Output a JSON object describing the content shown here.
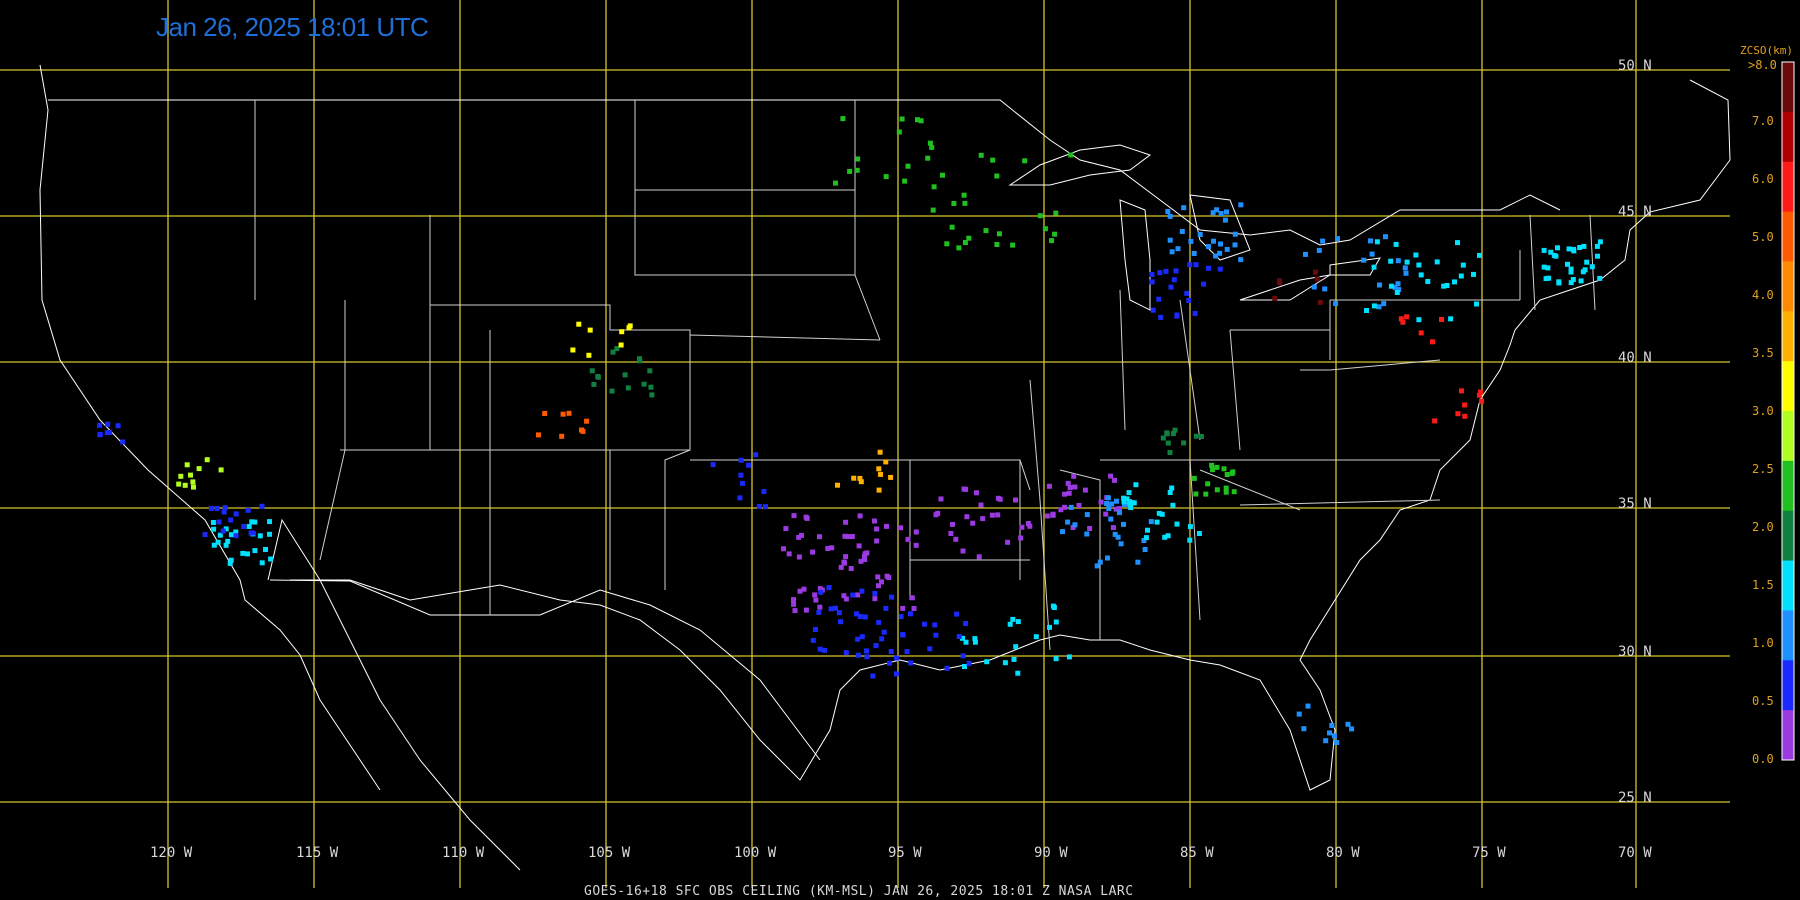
{
  "timestamp": "Jan 26, 2025 18:01 UTC",
  "footer": "GOES-16+18  SFC OBS CEILING (KM-MSL)   JAN 26, 2025 18:01 Z   NASA LARC",
  "latitude_labels": [
    "50 N",
    "45 N",
    "40 N",
    "35 N",
    "30 N",
    "25 N"
  ],
  "longitude_labels": [
    "120 W",
    "115 W",
    "110 W",
    "105 W",
    "100 W",
    "95 W",
    "90 W",
    "85 W",
    "80 W",
    "75 W",
    "70 W"
  ],
  "colorbar": {
    "title": "ZCSO(km)",
    "top_label": ">8.0",
    "ticks": [
      "7.0",
      "6.0",
      "5.0",
      "4.0",
      "3.5",
      "3.0",
      "2.5",
      "2.0",
      "1.5",
      "1.0",
      "0.5",
      "0.0"
    ],
    "colors": [
      "#6a0a0a",
      "#b00000",
      "#ff1a1a",
      "#ff5a00",
      "#ff8c00",
      "#ffb000",
      "#ffff00",
      "#b0ff20",
      "#20c020",
      "#108040",
      "#00e0ff",
      "#1f90ff",
      "#1a2aff",
      "#9a3ae0"
    ]
  },
  "colors": {
    "grid": "#d6c22e",
    "boundary": "#ffffff",
    "timestamp": "#1f6fd8"
  },
  "station_groups": [
    {
      "level": "0.0-0.5 km",
      "color": "#9a3ae0"
    },
    {
      "level": "0.5-1.0 km",
      "color": "#1a2aff"
    },
    {
      "level": "1.0-1.5 km",
      "color": "#1f90ff"
    },
    {
      "level": "1.5-2.0 km",
      "color": "#00e0ff"
    },
    {
      "level": "2.0-2.5 km",
      "color": "#108040"
    },
    {
      "level": "2.5-3.0 km",
      "color": "#20c020"
    },
    {
      "level": "3.0-3.5 km",
      "color": "#b0ff20"
    },
    {
      "level": "3.5-4.0 km",
      "color": "#ffff00"
    },
    {
      "level": "4.0-5.0 km",
      "color": "#ffb000"
    },
    {
      "level": "5.0-6.0 km",
      "color": "#ff5a00"
    },
    {
      "level": "6.0-7.0 km",
      "color": "#ff1a1a"
    },
    {
      "level": ">7.0 km",
      "color": "#6a0a0a"
    }
  ]
}
